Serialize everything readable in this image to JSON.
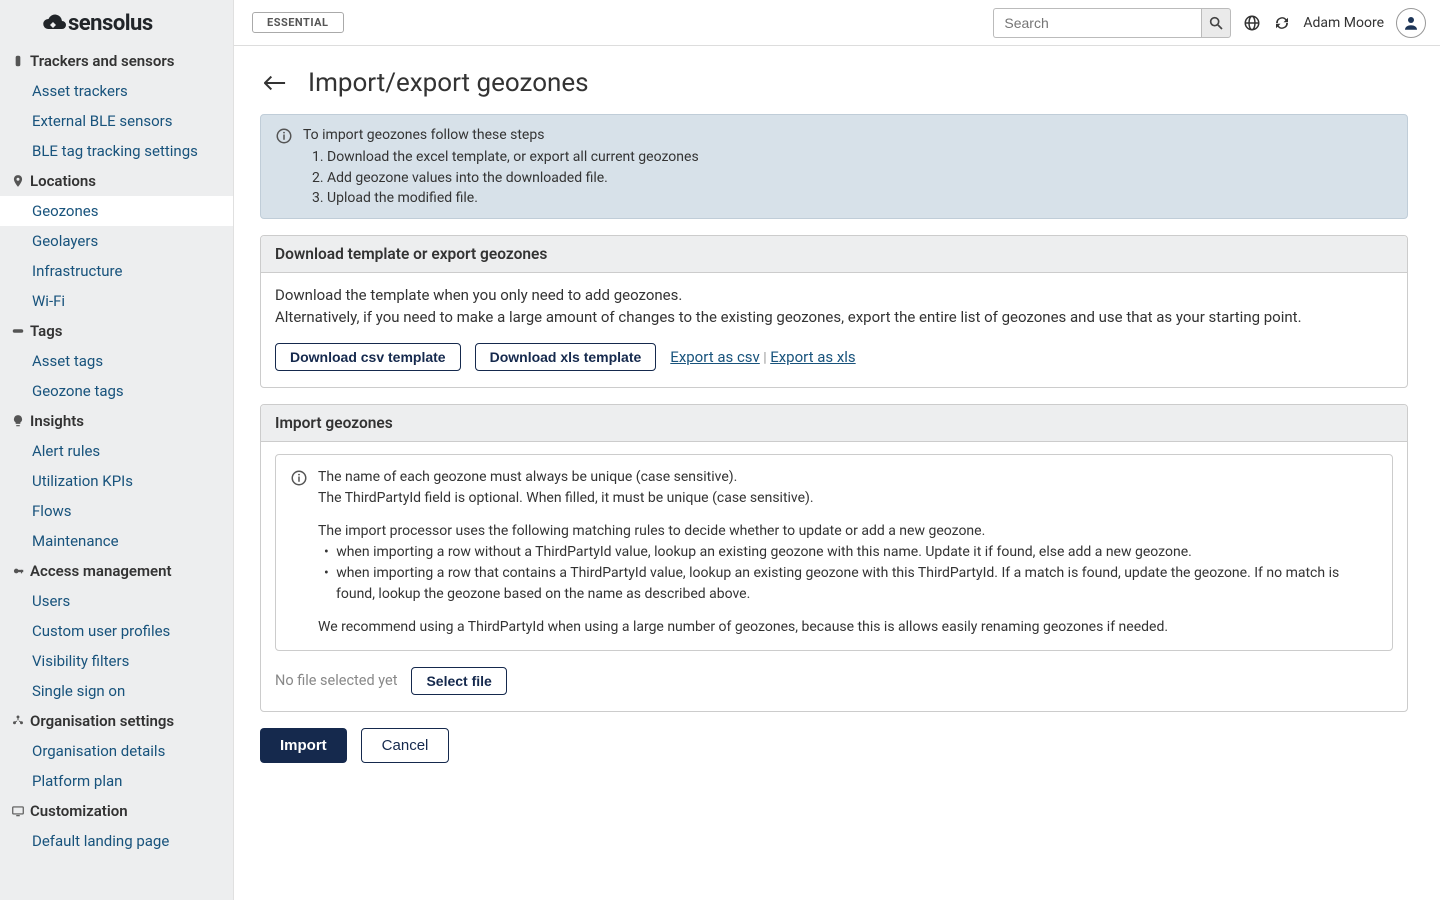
{
  "brand": "sensolus",
  "header": {
    "plan_badge": "ESSENTIAL",
    "search_placeholder": "Search",
    "username": "Adam Moore"
  },
  "sidebar": {
    "sections": [
      {
        "label": "Trackers and sensors",
        "items": [
          "Asset trackers",
          "External BLE sensors",
          "BLE tag tracking settings"
        ]
      },
      {
        "label": "Locations",
        "items": [
          "Geozones",
          "Geolayers",
          "Infrastructure",
          "Wi-Fi"
        ],
        "active_index": 0
      },
      {
        "label": "Tags",
        "items": [
          "Asset tags",
          "Geozone tags"
        ]
      },
      {
        "label": "Insights",
        "items": [
          "Alert rules",
          "Utilization KPIs",
          "Flows",
          "Maintenance"
        ]
      },
      {
        "label": "Access management",
        "items": [
          "Users",
          "Custom user profiles",
          "Visibility filters",
          "Single sign on"
        ]
      },
      {
        "label": "Organisation settings",
        "items": [
          "Organisation details",
          "Platform plan"
        ]
      },
      {
        "label": "Customization",
        "items": [
          "Default landing page"
        ]
      }
    ]
  },
  "page": {
    "title": "Import/export geozones",
    "info_intro": "To import geozones follow these steps",
    "info_steps": [
      "Download the excel template, or export all current geozones",
      "Add geozone values into the downloaded file.",
      "Upload the modified file."
    ],
    "download_section": {
      "title": "Download template or export geozones",
      "desc1": "Download the template when you only need to add geozones.",
      "desc2": "Alternatively, if you need to make a large amount of changes to the existing geozones, export the entire list of geozones and use that as your starting point.",
      "btn_csv": "Download csv template",
      "btn_xls": "Download xls template",
      "link_csv": " Export as csv",
      "link_xls": "Export as xls",
      "pipe": "|"
    },
    "import_section": {
      "title": "Import geozones",
      "note1": "The name of each geozone must always be unique (case sensitive).",
      "note2": "The ThirdPartyId field is optional. When filled, it must be unique (case sensitive).",
      "note3": "The import processor uses the following matching rules to decide whether to update or add a new geozone.",
      "bullet1": "when importing a row without a ThirdPartyId value, lookup an existing geozone with this name. Update it if found, else add a new geozone.",
      "bullet2": "when importing a row that contains a ThirdPartyId value, lookup an existing geozone with this ThirdPartyId. If a match is found, update the geozone. If no match is found, lookup the geozone based on the name as described above.",
      "note4": "We recommend using a ThirdPartyId when using a large number of geozones, because this is allows easily renaming geozones if needed.",
      "no_file": "No file selected yet",
      "select_file": "Select file"
    },
    "footer": {
      "import": "Import",
      "cancel": "Cancel"
    }
  }
}
